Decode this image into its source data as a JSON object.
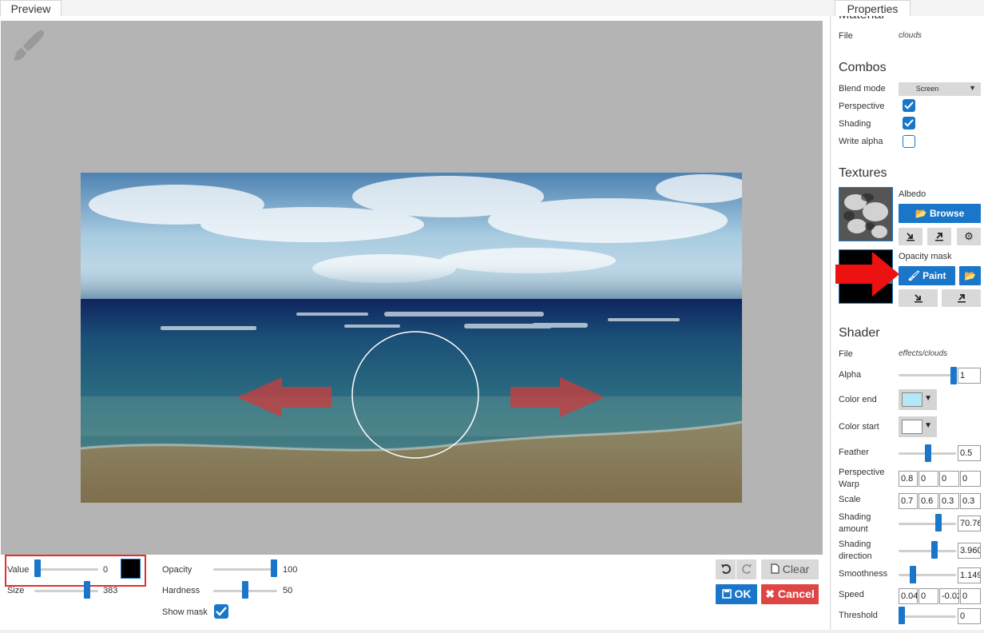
{
  "tabs": {
    "preview": "Preview",
    "properties": "Properties"
  },
  "toolbar": {
    "value_label": "Value",
    "value": "0",
    "size_label": "Size",
    "size": "383",
    "opacity_label": "Opacity",
    "opacity": "100",
    "hardness_label": "Hardness",
    "hardness": "50",
    "show_mask_label": "Show mask",
    "show_mask": true,
    "clear_label": "Clear",
    "ok_label": "OK",
    "cancel_label": "Cancel",
    "brush_color": "#000000"
  },
  "properties": {
    "material": {
      "heading": "Material",
      "file_label": "File",
      "file": "clouds"
    },
    "combos": {
      "heading": "Combos",
      "blend_mode_label": "Blend mode",
      "blend_mode": "Screen",
      "perspective_label": "Perspective",
      "perspective": true,
      "shading_label": "Shading",
      "shading": true,
      "write_alpha_label": "Write alpha",
      "write_alpha": false
    },
    "textures": {
      "heading": "Textures",
      "albedo_label": "Albedo",
      "browse_label": "Browse",
      "opacity_mask_label": "Opacity mask",
      "paint_label": "Paint"
    },
    "shader": {
      "heading": "Shader",
      "file_label": "File",
      "file": "effects/clouds",
      "alpha_label": "Alpha",
      "alpha": "1",
      "color_end_label": "Color end",
      "color_end": "#b4e8f5",
      "color_start_label": "Color start",
      "color_start": "#ffffff",
      "feather_label": "Feather",
      "feather": "0.5",
      "perspective_warp_label": "Perspective Warp",
      "perspective_warp": [
        "0.8",
        "0",
        "0",
        "0"
      ],
      "scale_label": "Scale",
      "scale": [
        "0.7",
        "0.6",
        "0.3",
        "0.3"
      ],
      "shading_amount_label": "Shading amount",
      "shading_amount": "70.76",
      "shading_direction_label": "Shading direction",
      "shading_direction": "3.960",
      "smoothness_label": "Smoothness",
      "smoothness": "1.149",
      "speed_label": "Speed",
      "speed": [
        "0.04",
        "0",
        "-0.02",
        "0"
      ],
      "threshold_label": "Threshold",
      "threshold": "0"
    }
  },
  "accent_color": "#1a76c9",
  "cancel_color": "#e04545"
}
